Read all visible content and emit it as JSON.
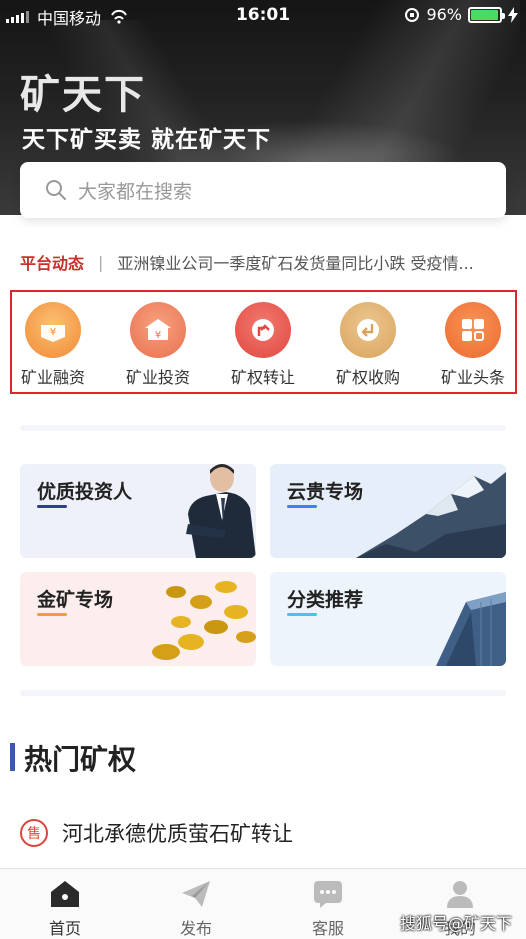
{
  "status_bar": {
    "carrier": "中国移动",
    "time": "16:01",
    "battery_percent": "96%",
    "battery_level": 0.96
  },
  "header": {
    "logo": "矿天下",
    "slogan": "天下矿买卖 就在矿天下"
  },
  "search": {
    "placeholder": "大家都在搜索"
  },
  "news": {
    "tag": "平台动态",
    "separator": "|",
    "text": "亚洲镍业公司一季度矿石发货量同比小跌 受疫情..."
  },
  "menu": {
    "items": [
      {
        "label": "矿业融资",
        "icon": "yen-money-icon",
        "color": "#f08a36"
      },
      {
        "label": "矿业投资",
        "icon": "yen-house-icon",
        "color": "#e9704f"
      },
      {
        "label": "矿权转让",
        "icon": "upload-arrow-icon",
        "color": "#e0473f"
      },
      {
        "label": "矿权收购",
        "icon": "return-arrow-icon",
        "color": "#d9a35e"
      },
      {
        "label": "矿业头条",
        "icon": "grid-apps-icon",
        "color": "#ee6a2e"
      }
    ]
  },
  "cards": [
    {
      "title": "优质投资人",
      "accent": "#2e3f8f"
    },
    {
      "title": "云贵专场",
      "accent": "#3b82f6"
    },
    {
      "title": "金矿专场",
      "accent": "#f0a030"
    },
    {
      "title": "分类推荐",
      "accent": "#40c8e8"
    }
  ],
  "section": {
    "title": "热门矿权"
  },
  "hot_list": [
    {
      "badge": "售",
      "text": "河北承德优质萤石矿转让"
    }
  ],
  "tabbar": {
    "tabs": [
      {
        "label": "首页",
        "icon": "home-icon",
        "active": true
      },
      {
        "label": "发布",
        "icon": "paper-plane-icon",
        "active": false
      },
      {
        "label": "客服",
        "icon": "chat-bubble-icon",
        "active": false
      },
      {
        "label": "我的",
        "icon": "user-icon",
        "active": false
      }
    ]
  },
  "watermark": "搜狐号@矿天下"
}
